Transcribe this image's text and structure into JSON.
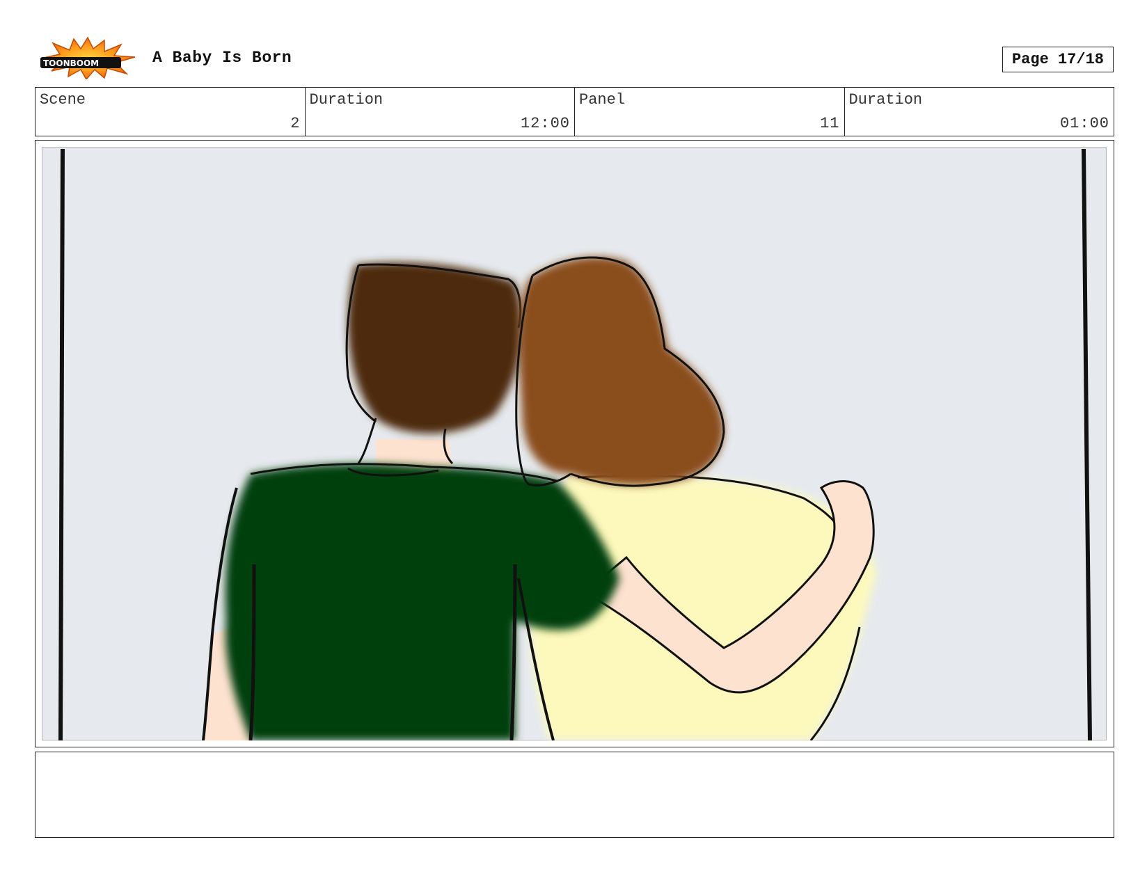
{
  "header": {
    "logo_text": "TOONBOOM",
    "title": "A Baby Is Born",
    "page_label": "Page 17/18"
  },
  "info": {
    "scene_label": "Scene",
    "scene_value": "2",
    "scene_duration_label": "Duration",
    "scene_duration_value": "12:00",
    "panel_label": "Panel",
    "panel_value": "11",
    "panel_duration_label": "Duration",
    "panel_duration_value": "01:00"
  },
  "notes": {
    "text": ""
  },
  "colors": {
    "background": "#e6eaee",
    "shirt_green": "#05400f",
    "shirt_yellow": "#fdf9bd",
    "hair_dark_brown": "#4e2b10",
    "hair_auburn": "#8a4d1a",
    "skin": "#fde2d0"
  }
}
